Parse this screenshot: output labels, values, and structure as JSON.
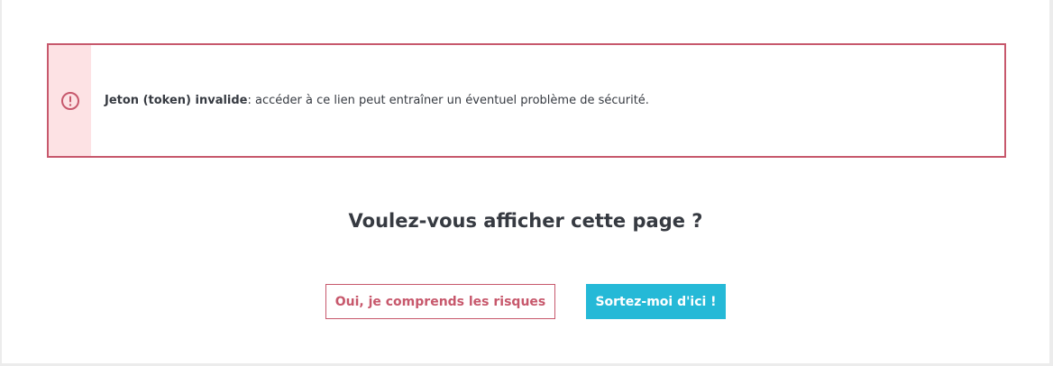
{
  "alert": {
    "icon": "exclamation-circle-icon",
    "title": "Jeton (token) invalide",
    "message": ": accéder à ce lien peut entraîner un éventuel problème de sécurité.",
    "colors": {
      "border": "#c7586c",
      "background": "#fde2e4"
    }
  },
  "question": "Voulez-vous afficher cette page ?",
  "buttons": {
    "accept_risk": "Oui, je comprends les risques",
    "leave": "Sortez-moi d'ici !"
  },
  "colors": {
    "danger": "#c7586c",
    "primary": "#25b9d7",
    "text": "#363a41"
  }
}
